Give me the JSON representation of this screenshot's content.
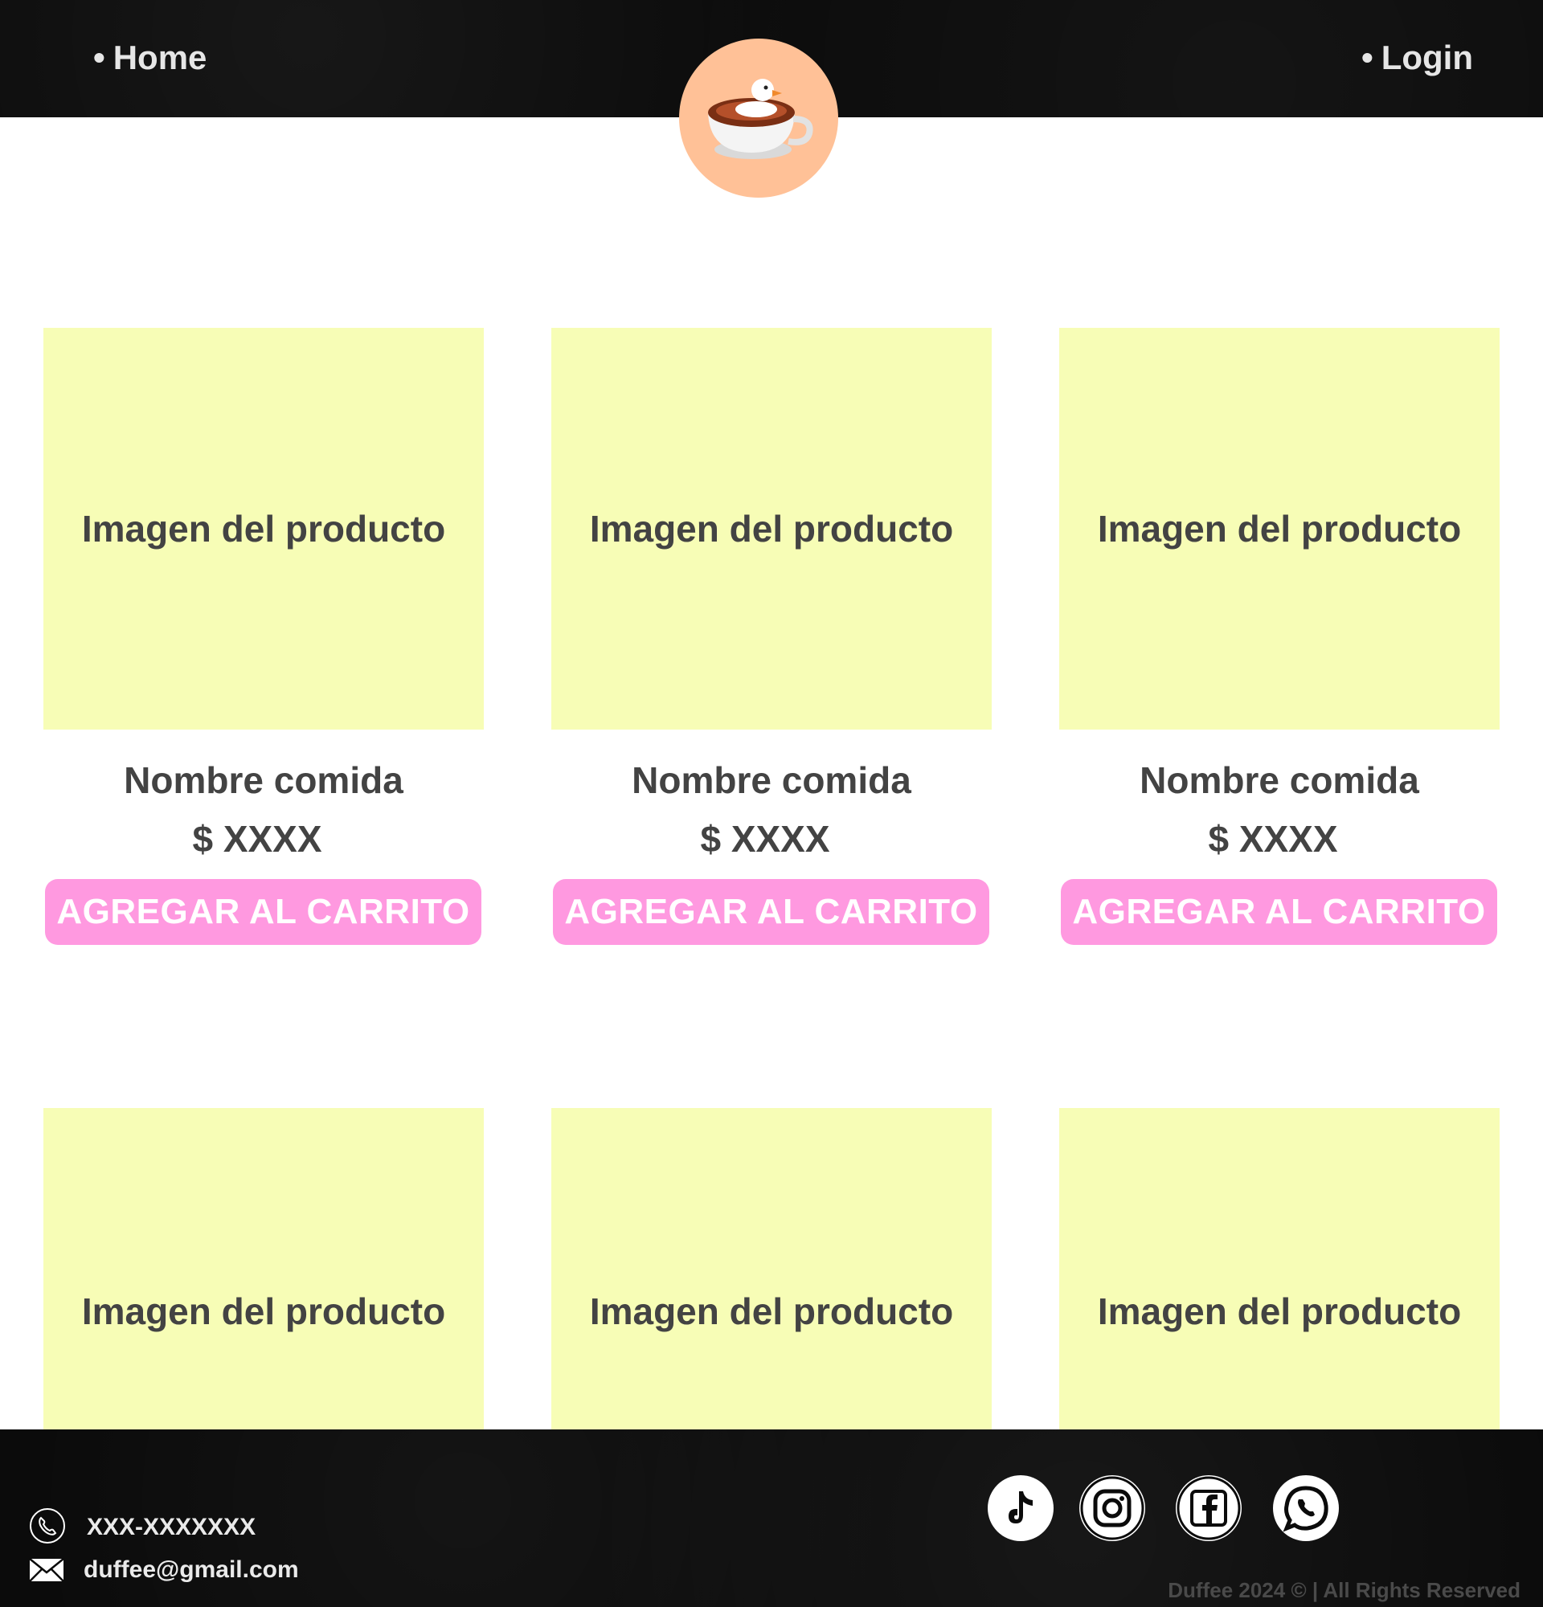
{
  "header": {
    "nav_left": "Home",
    "nav_right": "Login",
    "bullet": "•",
    "logo_icon": "duck-in-coffee-cup-icon"
  },
  "products": [
    {
      "image_placeholder": "Imagen del producto",
      "name": "Nombre comida",
      "price": "$ XXXX",
      "button": "AGREGAR AL CARRITO"
    },
    {
      "image_placeholder": "Imagen del producto",
      "name": "Nombre comida",
      "price": "$ XXXX",
      "button": "AGREGAR AL CARRITO"
    },
    {
      "image_placeholder": "Imagen del producto",
      "name": "Nombre comida",
      "price": "$ XXXX",
      "button": "AGREGAR AL CARRITO"
    },
    {
      "image_placeholder": "Imagen del producto"
    },
    {
      "image_placeholder": "Imagen del producto"
    },
    {
      "image_placeholder": "Imagen del producto"
    }
  ],
  "footer": {
    "phone": "XXX-XXXXXXX",
    "email": "duffee@gmail.com",
    "social": [
      "tiktok-icon",
      "instagram-icon",
      "facebook-icon",
      "whatsapp-icon"
    ],
    "copyright": "Duffee 2024 © | All Rights Reserved"
  },
  "colors": {
    "header_bg": "#0b0b0b",
    "card_bg": "#f7fdb6",
    "button_bg": "#ff99e0",
    "logo_bg": "#ffc197",
    "text_dark": "#434343"
  }
}
